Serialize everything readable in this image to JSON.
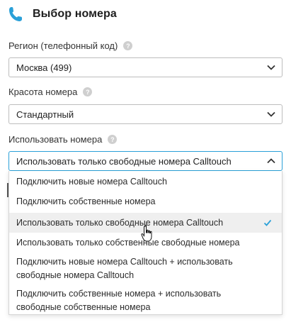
{
  "header": {
    "title": "Выбор номера",
    "icon": "phone-icon"
  },
  "region": {
    "label": "Регион (телефонный код)",
    "value": "Москва  (499)"
  },
  "beauty": {
    "label": "Красота номера",
    "value": "Стандартный"
  },
  "usage": {
    "label": "Использовать номера",
    "value": "Использовать только свободные номера Calltouch",
    "options": [
      {
        "label": "Подключить новые номера Calltouch"
      },
      {
        "label": "Подключить собственные номера"
      },
      {
        "label": "Использовать только свободные номера Calltouch",
        "selected": true
      },
      {
        "label": "Использовать только собственные свободные номера"
      },
      {
        "label": "Подключить новые номера Calltouch + использовать свободные номера Calltouch"
      },
      {
        "label": "Подключить собственные номера + использовать свободные собственные номера"
      }
    ]
  },
  "colors": {
    "accent": "#2aa0d8",
    "help": "#cfcfcf",
    "hover": "#efefef"
  }
}
